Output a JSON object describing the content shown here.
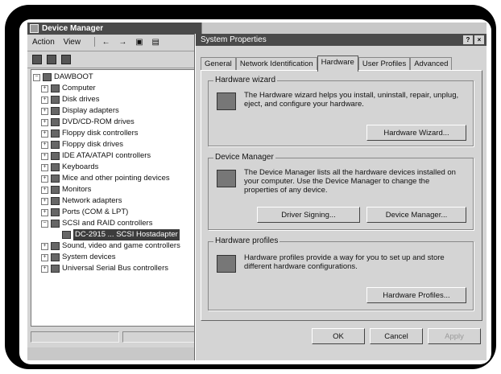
{
  "device_manager": {
    "title": "Device Manager",
    "menu": {
      "action": "Action",
      "view": "View"
    },
    "tree": {
      "root": "DAWBOOT",
      "items": [
        "Computer",
        "Disk drives",
        "Display adapters",
        "DVD/CD-ROM drives",
        "Floppy disk controllers",
        "Floppy disk drives",
        "IDE ATA/ATAPI controllers",
        "Keyboards",
        "Mice and other pointing devices",
        "Monitors",
        "Network adapters",
        "Ports (COM & LPT)",
        "SCSI and RAID controllers"
      ],
      "selected_child": "DC-2915 ... SCSI Hostadapter",
      "items_after": [
        "Sound, video and game controllers",
        "System devices",
        "Universal Serial Bus controllers"
      ]
    }
  },
  "system_properties": {
    "title": "System Properties",
    "title_buttons": {
      "help": "?",
      "close": "×"
    },
    "tabs": [
      "General",
      "Network Identification",
      "Hardware",
      "User Profiles",
      "Advanced"
    ],
    "active_tab": "Hardware",
    "hardware_wizard": {
      "title": "Hardware wizard",
      "text": "The Hardware wizard helps you install, uninstall, repair, unplug, eject, and configure your hardware.",
      "button": "Hardware Wizard..."
    },
    "device_manager": {
      "title": "Device Manager",
      "text": "The Device Manager lists all the hardware devices installed on your computer. Use the Device Manager to change the properties of any device.",
      "driver_signing_button": "Driver Signing...",
      "device_manager_button": "Device Manager..."
    },
    "hardware_profiles": {
      "title": "Hardware profiles",
      "text": "Hardware profiles provide a way for you to set up and store different hardware configurations.",
      "button": "Hardware Profiles..."
    },
    "footer": {
      "ok": "OK",
      "cancel": "Cancel",
      "apply": "Apply"
    }
  }
}
